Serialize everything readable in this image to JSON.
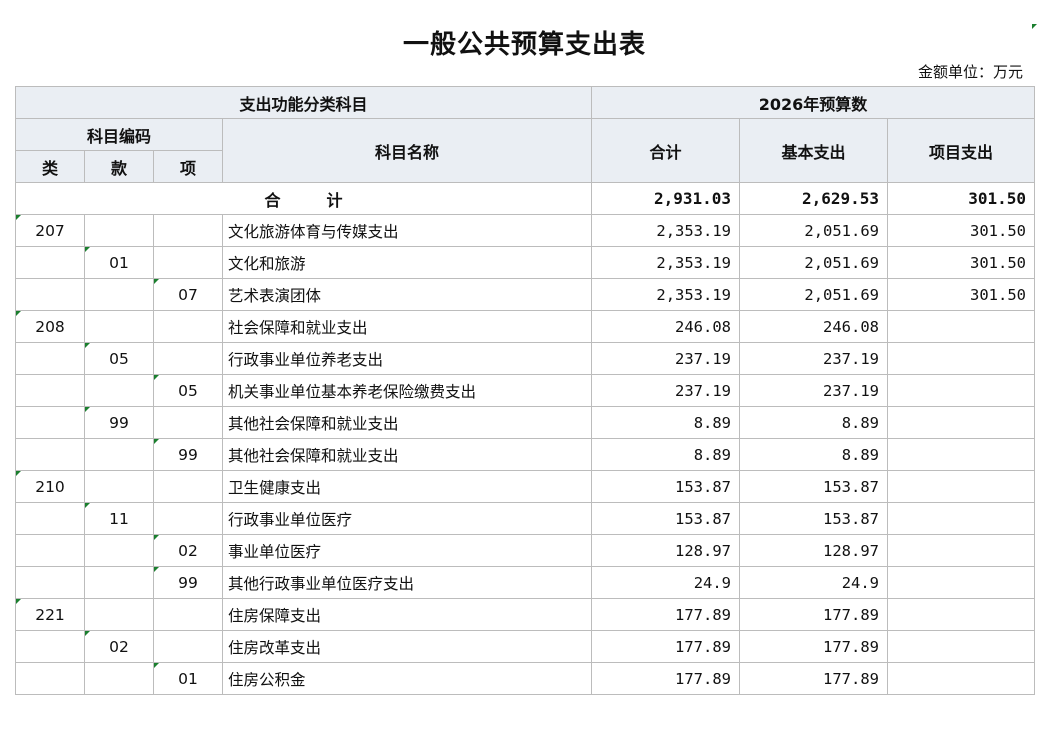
{
  "title": "一般公共预算支出表",
  "unit_label": "金额单位：万元",
  "header": {
    "func_class": "支出功能分类科目",
    "budget_year": "2026年预算数",
    "subject_code": "科目编码",
    "subject_name": "科目名称",
    "lei": "类",
    "kuan": "款",
    "xiang": "项",
    "total": "合计",
    "basic": "基本支出",
    "project": "项目支出"
  },
  "total_row": {
    "label_a": "合",
    "label_b": "计",
    "total": "2,931.03",
    "basic": "2,629.53",
    "project": "301.50"
  },
  "rows": [
    {
      "lei": "207",
      "kuan": "",
      "xiang": "",
      "name": "文化旅游体育与传媒支出",
      "total": "2,353.19",
      "basic": "2,051.69",
      "project": "301.50"
    },
    {
      "lei": "",
      "kuan": "01",
      "xiang": "",
      "name": "文化和旅游",
      "total": "2,353.19",
      "basic": "2,051.69",
      "project": "301.50"
    },
    {
      "lei": "",
      "kuan": "",
      "xiang": "07",
      "name": "艺术表演团体",
      "total": "2,353.19",
      "basic": "2,051.69",
      "project": "301.50"
    },
    {
      "lei": "208",
      "kuan": "",
      "xiang": "",
      "name": "社会保障和就业支出",
      "total": "246.08",
      "basic": "246.08",
      "project": ""
    },
    {
      "lei": "",
      "kuan": "05",
      "xiang": "",
      "name": "行政事业单位养老支出",
      "total": "237.19",
      "basic": "237.19",
      "project": ""
    },
    {
      "lei": "",
      "kuan": "",
      "xiang": "05",
      "name": "机关事业单位基本养老保险缴费支出",
      "total": "237.19",
      "basic": "237.19",
      "project": ""
    },
    {
      "lei": "",
      "kuan": "99",
      "xiang": "",
      "name": "其他社会保障和就业支出",
      "total": "8.89",
      "basic": "8.89",
      "project": ""
    },
    {
      "lei": "",
      "kuan": "",
      "xiang": "99",
      "name": "其他社会保障和就业支出",
      "total": "8.89",
      "basic": "8.89",
      "project": ""
    },
    {
      "lei": "210",
      "kuan": "",
      "xiang": "",
      "name": "卫生健康支出",
      "total": "153.87",
      "basic": "153.87",
      "project": ""
    },
    {
      "lei": "",
      "kuan": "11",
      "xiang": "",
      "name": "行政事业单位医疗",
      "total": "153.87",
      "basic": "153.87",
      "project": ""
    },
    {
      "lei": "",
      "kuan": "",
      "xiang": "02",
      "name": "事业单位医疗",
      "total": "128.97",
      "basic": "128.97",
      "project": ""
    },
    {
      "lei": "",
      "kuan": "",
      "xiang": "99",
      "name": "其他行政事业单位医疗支出",
      "total": "24.9",
      "basic": "24.9",
      "project": ""
    },
    {
      "lei": "221",
      "kuan": "",
      "xiang": "",
      "name": "住房保障支出",
      "total": "177.89",
      "basic": "177.89",
      "project": ""
    },
    {
      "lei": "",
      "kuan": "02",
      "xiang": "",
      "name": "住房改革支出",
      "total": "177.89",
      "basic": "177.89",
      "project": ""
    },
    {
      "lei": "",
      "kuan": "",
      "xiang": "01",
      "name": "住房公积金",
      "total": "177.89",
      "basic": "177.89",
      "project": ""
    }
  ],
  "colors": {
    "header_bg": "#eaeef3",
    "border": "#bcbcbc",
    "cell_marker": "#1a7f2e"
  }
}
